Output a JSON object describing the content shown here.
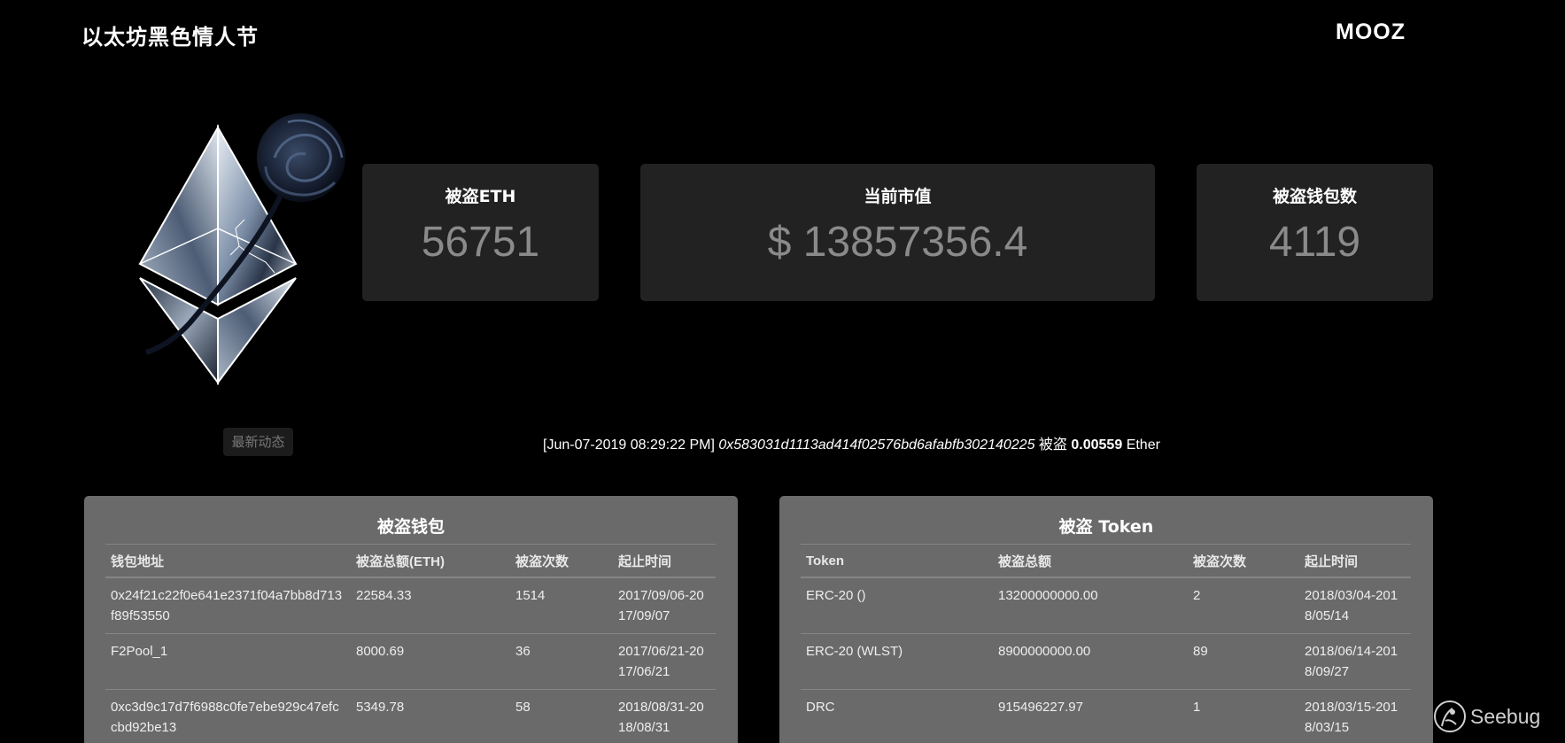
{
  "header": {
    "title": "以太坊黑色情人节",
    "brand": "MOOZ"
  },
  "stats": {
    "eth": {
      "label": "被盗ETH",
      "value": "56751"
    },
    "market_cap": {
      "label": "当前市值",
      "value": "$ 13857356.4"
    },
    "wallets": {
      "label": "被盗钱包数",
      "value": "4119"
    }
  },
  "news": {
    "tag": "最新动态",
    "timestamp": "[Jun-07-2019 08:29:22 PM]",
    "address": "0x583031d1113ad414f02576bd6afabfb302140225",
    "verb": "被盗",
    "amount": "0.00559",
    "unit": "Ether"
  },
  "wallet_table": {
    "title": "被盗钱包",
    "columns": [
      "钱包地址",
      "被盗总额(ETH)",
      "被盗次数",
      "起止时间"
    ],
    "rows": [
      [
        "0x24f21c22f0e641e2371f04a7bb8d713f89f53550",
        "22584.33",
        "1514",
        "2017/09/06-2017/09/07"
      ],
      [
        "F2Pool_1",
        "8000.69",
        "36",
        "2017/06/21-2017/06/21"
      ],
      [
        "0xc3d9c17d7f6988c0fe7ebe929c47efccbd92be13",
        "5349.78",
        "58",
        "2018/08/31-2018/08/31"
      ]
    ]
  },
  "token_table": {
    "title": "被盗 Token",
    "columns": [
      "Token",
      "被盗总额",
      "被盗次数",
      "起止时间"
    ],
    "rows": [
      [
        "ERC-20 ()",
        "13200000000.00",
        "2",
        "2018/03/04-2018/05/14"
      ],
      [
        "ERC-20 (WLST)",
        "8900000000.00",
        "89",
        "2018/06/14-2018/09/27"
      ],
      [
        "DRC",
        "915496227.97",
        "1",
        "2018/03/15-2018/03/15"
      ]
    ]
  },
  "watermark": {
    "text": "Seebug"
  },
  "colors": {
    "background": "#000000",
    "card": "#222222",
    "panel": "#6a6a6a",
    "stat_value": "#8a8a8a"
  }
}
